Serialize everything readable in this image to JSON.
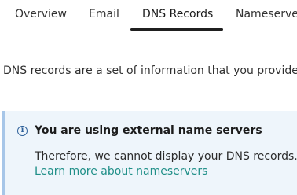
{
  "tabs": {
    "items": [
      {
        "label": "Overview"
      },
      {
        "label": "Email"
      },
      {
        "label": "DNS Records",
        "active": true
      },
      {
        "label": "Nameservers"
      }
    ]
  },
  "intro": {
    "text": "DNS records are a set of information that you provide that"
  },
  "notice": {
    "icon": "info-icon",
    "icon_glyph": "i",
    "title": "You are using external name servers",
    "body": "Therefore, we cannot display your DNS records.",
    "link": "Learn more about nameservers",
    "accent_color": "#a7c6e8",
    "background_color": "#eef5fb",
    "link_color": "#1f8f88"
  }
}
